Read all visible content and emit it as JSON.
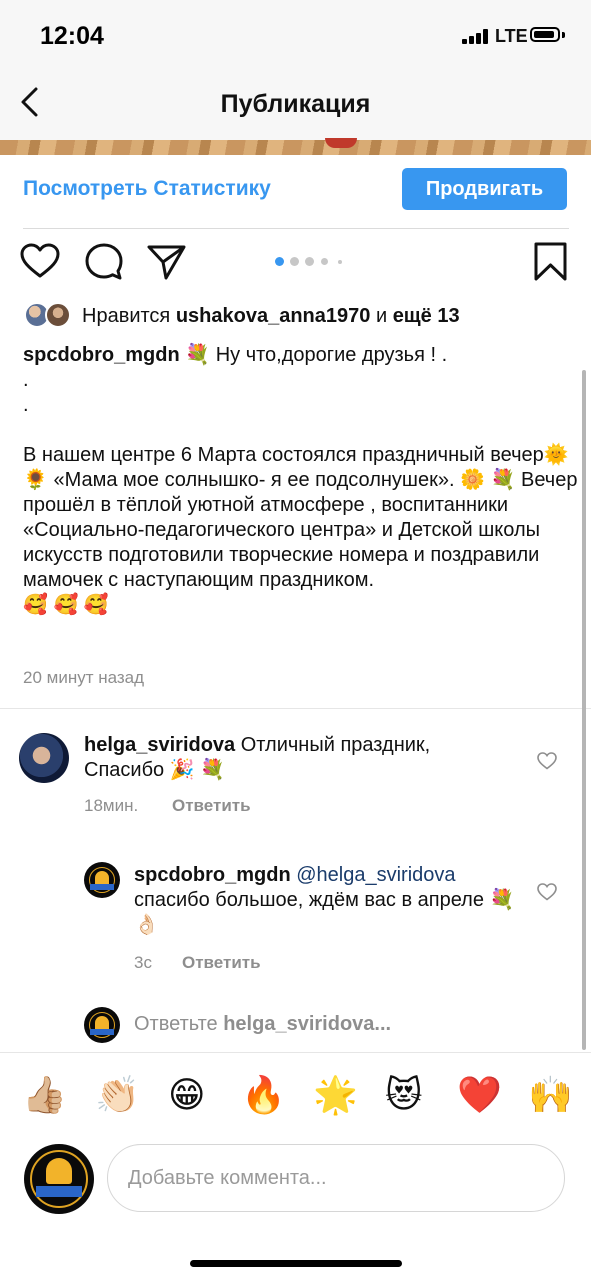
{
  "status_bar": {
    "time": "12:04",
    "network": "LTE"
  },
  "header": {
    "title": "Публикация",
    "back_icon": "chevron-left-icon"
  },
  "post_actions": {
    "stats_label": "Посмотреть Статистику",
    "promote_label": "Продвигать",
    "icons": [
      "heart-icon",
      "comment-icon",
      "share-icon",
      "bookmark-icon"
    ],
    "carousel": {
      "count": 5,
      "active": 1
    }
  },
  "likes": {
    "prefix": "Нравится",
    "user": "ushakova_anna1970",
    "middle": "и",
    "others": "ещё 13"
  },
  "caption": {
    "username": "spcdobro_mgdn",
    "text": "💐 Ну что,дорогие друзья ! .\n.\n.\n\nВ нашем центре 6 Марта состоялся праздничный вечер🌞 🌻 «Мама мое солнышко- я ее подсолнушек». 🌼 💐 Вечер прошёл в тёплой уютной атмосфере , воспитанники «Социально-педагогического центра» и Детской школы искусств подготовили творческие номера и поздравили мамочек с наступающим праздником.\n🥰 🥰 🥰",
    "time": "20 минут назад"
  },
  "comments": [
    {
      "username": "helga_sviridova",
      "text": "Отличный праздник, Спасибо 🎉 💐",
      "time": "18мин.",
      "reply_label": "Ответить"
    },
    {
      "username": "spcdobro_mgdn",
      "mention": "@helga_sviridova",
      "text": "спасибо большое, ждём вас в апреле 💐 👌🏻",
      "time": "3с",
      "reply_label": "Ответить"
    }
  ],
  "reply_prompt": {
    "prefix": "Ответьте",
    "user": "helga_sviridova..."
  },
  "quick_emojis": [
    "👍🏼",
    "👏🏻",
    "😁",
    "🔥",
    "🌟",
    "😻",
    "❤️",
    "🙌"
  ],
  "composer": {
    "placeholder": "Добавьте коммента..."
  },
  "colors": {
    "accent": "#3897f0",
    "muted": "#8e8e8e",
    "mention": "#1b3c6b"
  }
}
